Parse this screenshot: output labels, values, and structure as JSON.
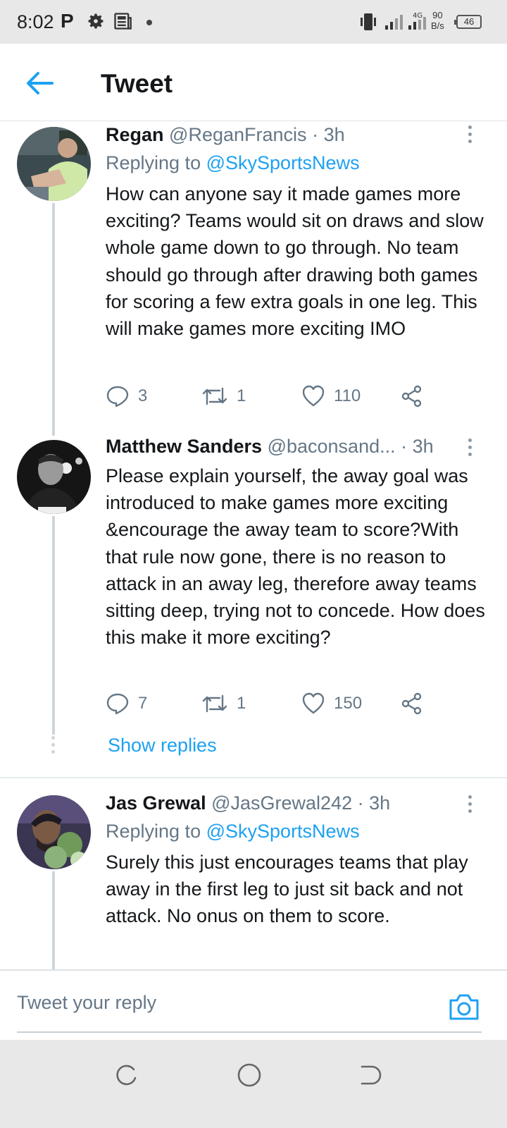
{
  "status_bar": {
    "time": "8:02",
    "p_label": "P",
    "network": "4G",
    "speed_value": "90",
    "speed_unit": "B/s",
    "battery": "46"
  },
  "header": {
    "title": "Tweet",
    "back_icon": "arrow-left-icon"
  },
  "colors": {
    "accent": "#1da1f2",
    "text": "#14171a",
    "muted": "#657786",
    "statusbar_bg": "#e8e8e8"
  },
  "tweets": [
    {
      "name": "Regan",
      "handle": "@ReganFrancis",
      "separator": "·",
      "time": "3h",
      "replying_prefix": "Replying to",
      "replying_to": "@SkySportsNews",
      "text": "How can anyone say it made games more exciting? Teams would sit on draws and slow whole game down to go through. No team should go through after drawing both games for scoring a few extra goals in one leg. This will make games more exciting IMO",
      "replies": "3",
      "retweets": "1",
      "likes": "110"
    },
    {
      "name": "Matthew Sanders",
      "handle": "@baconsand...",
      "separator": "·",
      "time": "3h",
      "text": "Please explain yourself, the away goal was introduced to make games more exciting &encourage the away team to score?With that rule now gone, there is no reason to attack in an away leg, therefore away teams sitting deep, trying not to concede. How does this make it more exciting?",
      "replies": "7",
      "retweets": "1",
      "likes": "150",
      "show_replies": "Show replies"
    },
    {
      "name": "Jas Grewal",
      "handle": "@JasGrewal242",
      "separator": "·",
      "time": "3h",
      "replying_prefix": "Replying to",
      "replying_to": "@SkySportsNews",
      "text": "Surely this just encourages teams that play away in the first leg to just sit back and not attack. No onus on them to score."
    }
  ],
  "reply_bar": {
    "placeholder": "Tweet your reply",
    "camera_icon": "camera-icon"
  },
  "nav_bar": {
    "icons": [
      "recents-icon",
      "home-icon",
      "back-icon"
    ]
  }
}
